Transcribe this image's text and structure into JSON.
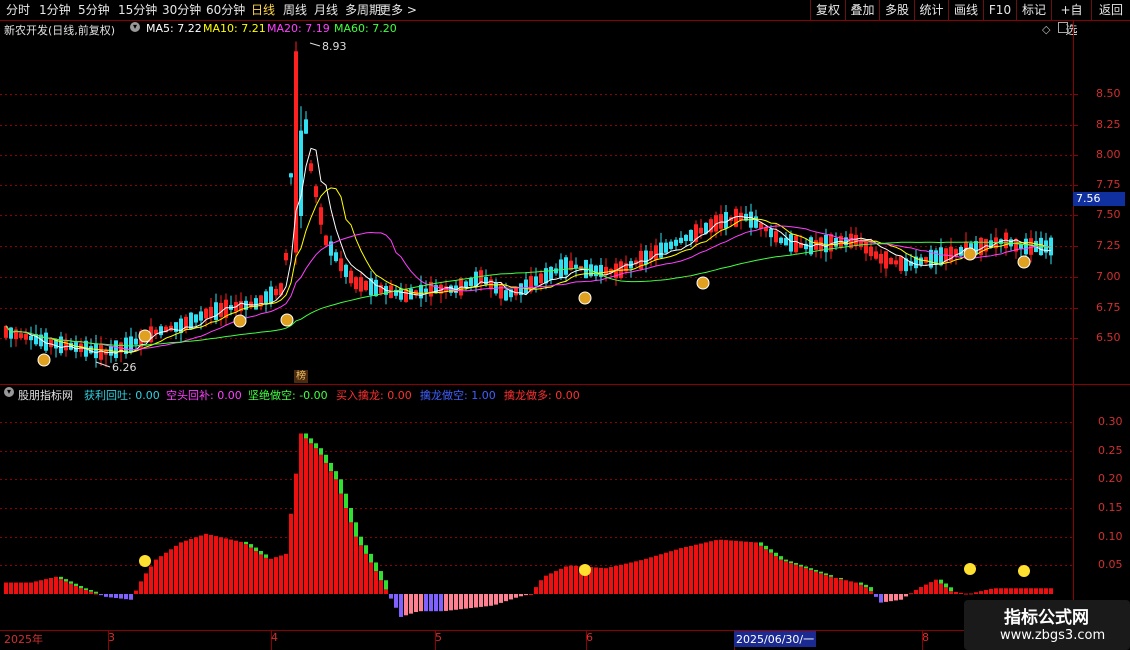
{
  "toolbar": {
    "periods": [
      "分时",
      "1分钟",
      "5分钟",
      "15分钟",
      "30分钟",
      "60分钟",
      "日线",
      "周线",
      "月线",
      "多周期",
      "更多 >"
    ],
    "active_period": "日线",
    "right_buttons": [
      "复权",
      "叠加",
      "多股",
      "统计",
      "画线",
      "F10",
      "标记",
      "+自选",
      "返回"
    ]
  },
  "main_panel": {
    "title": "新农开发(日线,前复权)",
    "ma": [
      {
        "label": "MA5: 7.22",
        "color": "#ffffff"
      },
      {
        "label": "MA10: 7.21",
        "color": "#ffff00"
      },
      {
        "label": "MA20: 7.19",
        "color": "#ff40ff"
      },
      {
        "label": "MA60: 7.20",
        "color": "#40ff40"
      }
    ],
    "high_label": "8.93",
    "low_label": "6.26",
    "bang_label": "榜",
    "price_tag": "7.56",
    "y_axis": [
      "8.50",
      "8.25",
      "8.00",
      "7.75",
      "7.50",
      "7.25",
      "7.00",
      "6.75",
      "6.50"
    ]
  },
  "sub_panel": {
    "title": "股朋指标网",
    "indicators": [
      {
        "label": "获利回吐: 0.00",
        "color": "#30d0e0"
      },
      {
        "label": "空头回补: 0.00",
        "color": "#ff40ff"
      },
      {
        "label": "坚绝做空: -0.00",
        "color": "#40ff40"
      },
      {
        "label": "买入擒龙: 0.00",
        "color": "#ff3030"
      },
      {
        "label": "擒龙做空: 1.00",
        "color": "#4060ff"
      },
      {
        "label": "擒龙做多: 0.00",
        "color": "#ff3030"
      }
    ],
    "y_axis": [
      "0.30",
      "0.25",
      "0.20",
      "0.15",
      "0.10",
      "0.05"
    ]
  },
  "x_axis": {
    "labels": [
      "2025年",
      "3",
      "4",
      "5",
      "6",
      "2025/06/30/一",
      "8"
    ]
  },
  "watermark": {
    "line1": "指标公式网",
    "line2": "www.zbgs3.com"
  },
  "colors": {
    "up": "#ff2020",
    "down": "#30e0f0",
    "grid": "#8b0000",
    "ma5": "#ffffff",
    "ma10": "#ffff00",
    "ma20": "#ff40ff",
    "ma60": "#40ff40",
    "hist_red": "#ee1010",
    "hist_green": "#30e030",
    "hist_purple": "#8060ff",
    "hist_pink": "#ff8090"
  },
  "chart_data": {
    "type": "candlestick",
    "ylim": [
      6.26,
      8.93
    ],
    "trend": [
      [
        0,
        6.55
      ],
      [
        10,
        6.5
      ],
      [
        20,
        6.45
      ],
      [
        30,
        6.42
      ],
      [
        40,
        6.38
      ],
      [
        50,
        6.45
      ],
      [
        60,
        6.55
      ],
      [
        70,
        6.6
      ],
      [
        80,
        6.7
      ],
      [
        90,
        6.75
      ],
      [
        100,
        6.78
      ],
      [
        110,
        6.9
      ],
      [
        113,
        7.3
      ],
      [
        116,
        8.9
      ],
      [
        122,
        7.9
      ],
      [
        128,
        7.3
      ],
      [
        134,
        7.1
      ],
      [
        140,
        6.95
      ],
      [
        150,
        6.9
      ],
      [
        160,
        6.85
      ],
      [
        170,
        6.9
      ],
      [
        180,
        6.9
      ],
      [
        190,
        7.0
      ],
      [
        200,
        6.85
      ],
      [
        206,
        6.9
      ],
      [
        215,
        7.0
      ],
      [
        225,
        7.1
      ],
      [
        235,
        7.05
      ],
      [
        245,
        7.05
      ],
      [
        255,
        7.15
      ],
      [
        265,
        7.25
      ],
      [
        275,
        7.35
      ],
      [
        285,
        7.45
      ],
      [
        295,
        7.5
      ],
      [
        300,
        7.45
      ],
      [
        310,
        7.3
      ],
      [
        320,
        7.25
      ],
      [
        330,
        7.28
      ],
      [
        340,
        7.3
      ],
      [
        350,
        7.15
      ],
      [
        360,
        7.1
      ],
      [
        370,
        7.15
      ],
      [
        380,
        7.2
      ],
      [
        390,
        7.25
      ],
      [
        400,
        7.3
      ],
      [
        405,
        7.25
      ]
    ],
    "oscillator_trend": [
      [
        0,
        0.02
      ],
      [
        10,
        0.02
      ],
      [
        20,
        0.03
      ],
      [
        30,
        0.01
      ],
      [
        40,
        -0.005
      ],
      [
        50,
        -0.01
      ],
      [
        55,
        0.03
      ],
      [
        60,
        0.06
      ],
      [
        70,
        0.09
      ],
      [
        80,
        0.105
      ],
      [
        85,
        0.1
      ],
      [
        95,
        0.09
      ],
      [
        105,
        0.06
      ],
      [
        112,
        0.07
      ],
      [
        118,
        0.28
      ],
      [
        125,
        0.25
      ],
      [
        132,
        0.2
      ],
      [
        140,
        0.1
      ],
      [
        148,
        0.04
      ],
      [
        153,
        0.0
      ],
      [
        158,
        -0.04
      ],
      [
        165,
        -0.03
      ],
      [
        175,
        -0.03
      ],
      [
        185,
        -0.025
      ],
      [
        195,
        -0.02
      ],
      [
        205,
        -0.005
      ],
      [
        210,
        0.0
      ],
      [
        215,
        0.03
      ],
      [
        225,
        0.05
      ],
      [
        240,
        0.045
      ],
      [
        255,
        0.06
      ],
      [
        270,
        0.08
      ],
      [
        285,
        0.095
      ],
      [
        300,
        0.09
      ],
      [
        310,
        0.06
      ],
      [
        320,
        0.045
      ],
      [
        330,
        0.03
      ],
      [
        340,
        0.02
      ],
      [
        345,
        0.01
      ],
      [
        350,
        -0.015
      ],
      [
        358,
        -0.01
      ],
      [
        365,
        0.01
      ],
      [
        372,
        0.025
      ],
      [
        378,
        0.005
      ],
      [
        385,
        0.0
      ],
      [
        395,
        0.01
      ],
      [
        405,
        0.01
      ]
    ]
  }
}
